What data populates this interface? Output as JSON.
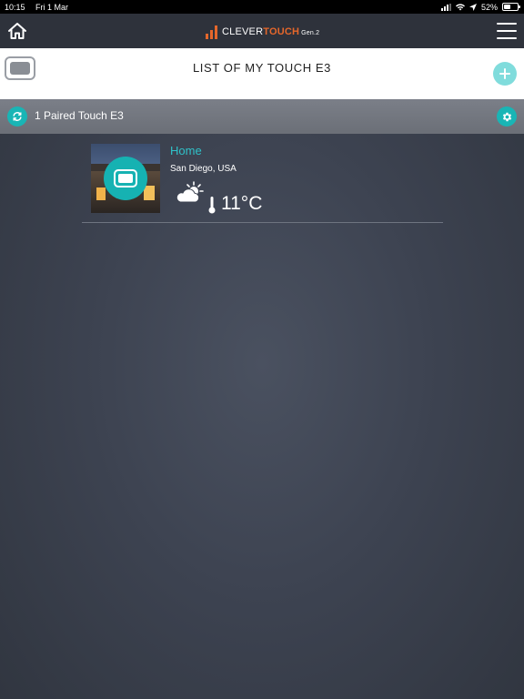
{
  "status_bar": {
    "time": "10:15",
    "date": "Fri 1 Mar",
    "battery": "52%",
    "battery_level": 0.52
  },
  "header": {
    "brand_left": "CLEVER",
    "brand_right": "TOUCH",
    "brand_gen": "Gen.2",
    "home_icon": "home-icon",
    "menu_icon": "hamburger-menu-icon"
  },
  "title_bar": {
    "title": "LIST OF MY TOUCH E3",
    "device_icon": "device-screen-icon",
    "add_icon": "plus-icon"
  },
  "paired_bar": {
    "label": "1 Paired Touch E3",
    "refresh_icon": "refresh-icon",
    "settings_icon": "gear-icon"
  },
  "devices": [
    {
      "name": "Home",
      "location": "San Diego, USA",
      "weather_icon": "partly-cloudy-icon",
      "temperature": "11°C"
    }
  ],
  "colors": {
    "accent": "#19b5b5",
    "accent_light": "#80dcdc",
    "brand_orange": "#e5672b",
    "device_name": "#2fc2c9",
    "background": "#3d4351"
  }
}
